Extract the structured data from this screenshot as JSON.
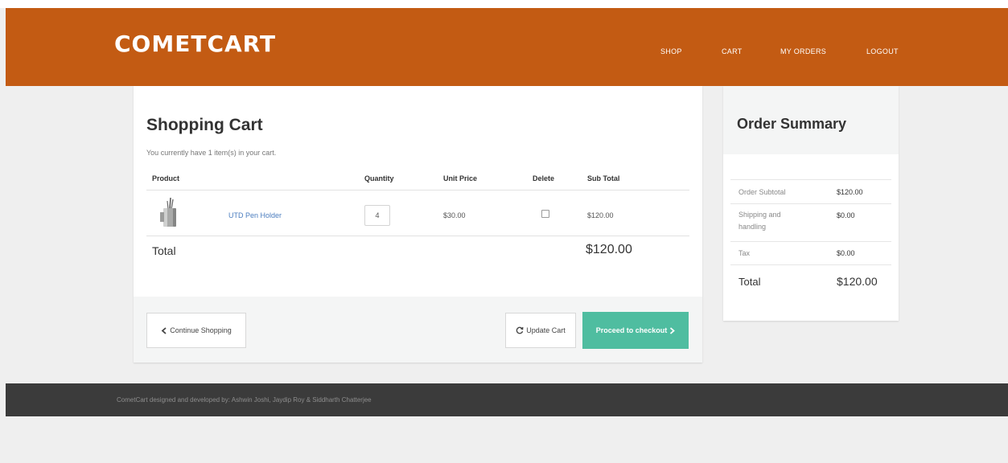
{
  "header": {
    "brand": "COMETCART",
    "nav": [
      {
        "label": "SHOP"
      },
      {
        "label": "CART"
      },
      {
        "label": "MY ORDERS"
      },
      {
        "label": "LOGOUT"
      }
    ]
  },
  "cart": {
    "title": "Shopping Cart",
    "subtitle": "You currently have 1 item(s) in your cart.",
    "columns": [
      "Product",
      "Quantity",
      "Unit Price",
      "Delete",
      "Sub Total"
    ],
    "items": [
      {
        "thumbnail_icon": "pen-holder-image",
        "name": "UTD Pen Holder",
        "quantity": "4",
        "unit_price": "$30.00",
        "delete_checked": false,
        "subtotal": "$120.00"
      }
    ],
    "total_label": "Total",
    "total_value": "$120.00",
    "buttons": {
      "continue": {
        "icon": "chevron-left-icon",
        "label": "Continue Shopping"
      },
      "update": {
        "icon": "refresh-icon",
        "label": "Update Cart"
      },
      "checkout": {
        "label": "Proceed to checkout",
        "icon": "chevron-right-icon"
      }
    }
  },
  "summary": {
    "title": "Order Summary",
    "rows": [
      {
        "label": "Order Subtotal",
        "value": "$120.00"
      },
      {
        "label": "Shipping and handling",
        "value": "$0.00"
      },
      {
        "label": "Tax",
        "value": "$0.00"
      }
    ],
    "total_label": "Total",
    "total_value": "$120.00"
  },
  "footer": {
    "text": "CometCart designed and developed by: Ashwin Joshi, Jaydip Roy & Siddharth Chatterjee"
  },
  "colors": {
    "navbar": "#c35b13",
    "checkout_button": "#4fbda0",
    "link": "#4b7dbf",
    "footer": "#3b3b3b"
  }
}
